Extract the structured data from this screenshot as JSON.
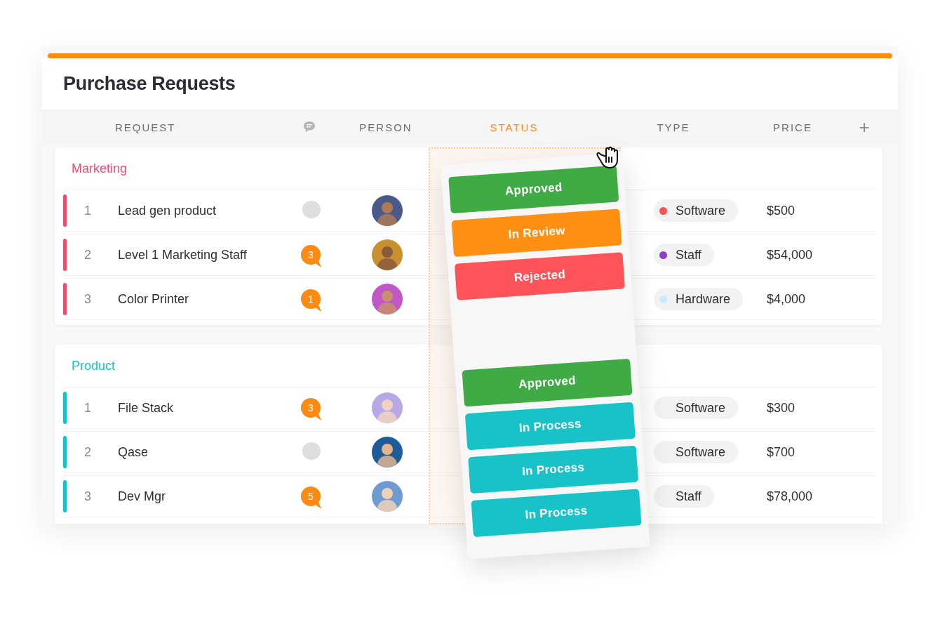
{
  "title": "Purchase Requests",
  "columns": [
    {
      "kind": "text",
      "label": "REQUEST",
      "highlighted": false
    },
    {
      "kind": "comments",
      "highlighted": false
    },
    {
      "kind": "text",
      "label": "PERSON",
      "highlighted": false
    },
    {
      "kind": "text",
      "label": "STATUS",
      "highlighted": true
    },
    {
      "kind": "text",
      "label": "TYPE",
      "highlighted": false
    },
    {
      "kind": "text",
      "label": "PRICE",
      "highlighted": false
    }
  ],
  "add_column": "+",
  "groups": [
    {
      "name": "Marketing",
      "color": "#e9506f",
      "rows": [
        {
          "kind": "full",
          "number": "1",
          "request": "Lead gen product",
          "type": "Software",
          "color": "#f05454",
          "price": "$500"
        },
        {
          "kind": "full",
          "number": "2",
          "request": "Level 1 Marketing Staff",
          "comments": "3",
          "type": "Staff",
          "color": "#8a3fd1",
          "price": "$54,000"
        },
        {
          "kind": "full",
          "number": "3",
          "request": "Color Printer",
          "comments": "1",
          "type": "Hardware",
          "color": "#cdebf7",
          "price": "$4,000"
        }
      ]
    },
    {
      "name": "Product",
      "color": "#17c3c6",
      "rows": [
        {
          "kind": "full",
          "number": "1",
          "request": "File Stack",
          "comments": "3",
          "type": "Software",
          "price": "$300"
        },
        {
          "kind": "full",
          "number": "2",
          "request": "Qase",
          "type": "Software",
          "price": "$700"
        },
        {
          "kind": "full",
          "number": "3",
          "request": "Dev Mgr",
          "comments": "5",
          "type": "Staff",
          "price": "$78,000"
        },
        {
          "kind": "partial"
        }
      ]
    }
  ],
  "drag_column": {
    "groups": [
      {
        "statuses": [
          {
            "label": "Approved",
            "color": "#40ab45"
          },
          {
            "label": "In Review",
            "color": "#fd9012"
          },
          {
            "label": "Rejected",
            "color": "#fd5459"
          }
        ]
      },
      {
        "statuses": [
          {
            "label": "Approved",
            "color": "#40ab45"
          },
          {
            "label": "In Process",
            "color": "#17c3c6"
          },
          {
            "label": "In Process",
            "color": "#17c3c6"
          },
          {
            "label": "In Process",
            "color": "#17c3c6"
          }
        ]
      }
    ]
  }
}
